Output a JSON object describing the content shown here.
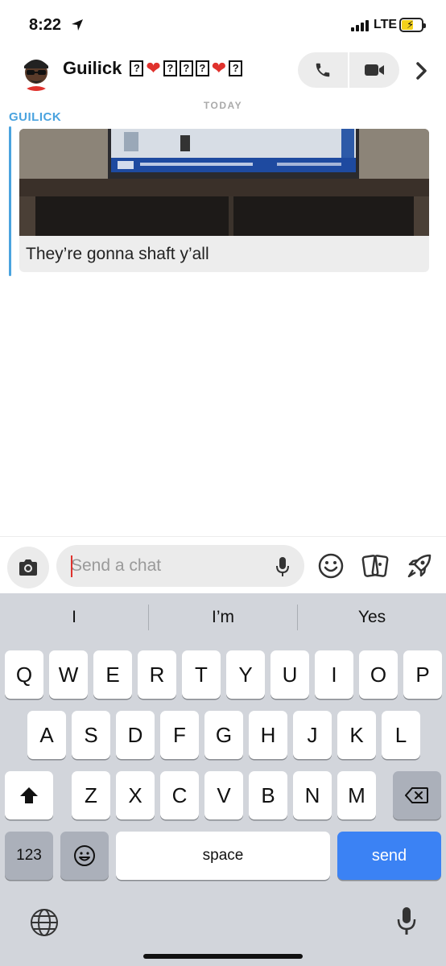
{
  "status_bar": {
    "time": "8:22",
    "network": "LTE"
  },
  "header": {
    "contact_name": "Guilick",
    "name_symbols": [
      "?",
      "❤",
      "?",
      "?",
      "?",
      "❤",
      "?"
    ]
  },
  "chat": {
    "day_label": "TODAY",
    "sender_label": "GUILICK",
    "message_caption": "They’re gonna shaft y’all"
  },
  "input": {
    "placeholder": "Send a chat"
  },
  "keyboard": {
    "suggestions": [
      "I",
      "I’m",
      "Yes"
    ],
    "row1": [
      "Q",
      "W",
      "E",
      "R",
      "T",
      "Y",
      "U",
      "I",
      "O",
      "P"
    ],
    "row2": [
      "A",
      "S",
      "D",
      "F",
      "G",
      "H",
      "J",
      "K",
      "L"
    ],
    "row3": [
      "Z",
      "X",
      "C",
      "V",
      "B",
      "N",
      "M"
    ],
    "numbers_label": "123",
    "space_label": "space",
    "send_label": "send"
  },
  "colors": {
    "accent_blue": "#4aa3df",
    "send_blue": "#3b82f4",
    "heart_red": "#e0322d",
    "battery_yellow": "#f4d21b"
  }
}
